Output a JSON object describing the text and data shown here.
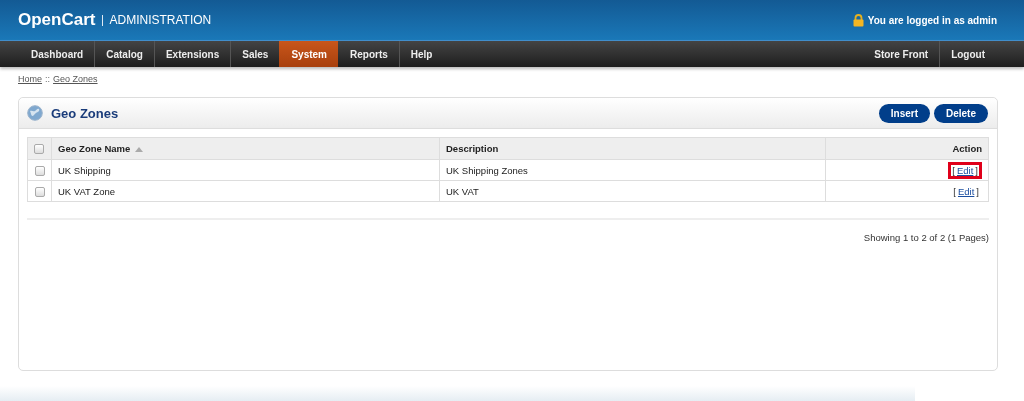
{
  "header": {
    "logo": "OpenCart",
    "subtitle": "ADMINISTRATION",
    "login_text": "You are logged in as admin"
  },
  "nav": {
    "left": [
      {
        "label": "Dashboard",
        "selected": false
      },
      {
        "label": "Catalog",
        "selected": false
      },
      {
        "label": "Extensions",
        "selected": false
      },
      {
        "label": "Sales",
        "selected": false
      },
      {
        "label": "System",
        "selected": true
      },
      {
        "label": "Reports",
        "selected": false
      },
      {
        "label": "Help",
        "selected": false
      }
    ],
    "right": [
      {
        "label": "Store Front",
        "selected": false
      },
      {
        "label": "Logout",
        "selected": false
      }
    ]
  },
  "breadcrumb": {
    "items": [
      "Home",
      "Geo Zones"
    ],
    "separator": "::"
  },
  "panel": {
    "title": "Geo Zones",
    "buttons": [
      "Insert",
      "Delete"
    ]
  },
  "table": {
    "columns": [
      {
        "label": "Geo Zone Name",
        "sorted": true
      },
      {
        "label": "Description",
        "sorted": false
      },
      {
        "label": "Action",
        "sorted": false
      }
    ],
    "header_checked": false,
    "rows": [
      {
        "checked": false,
        "name": "UK Shipping",
        "description": "UK Shipping Zones",
        "action": {
          "open": "[",
          "link": "Edit",
          "close": "]",
          "highlighted": true
        }
      },
      {
        "checked": false,
        "name": "UK VAT Zone",
        "description": "UK VAT",
        "action": {
          "open": "[",
          "link": "Edit",
          "close": "]",
          "highlighted": false
        }
      }
    ]
  },
  "pagination": "Showing 1 to 2 of 2 (1 Pages)"
}
